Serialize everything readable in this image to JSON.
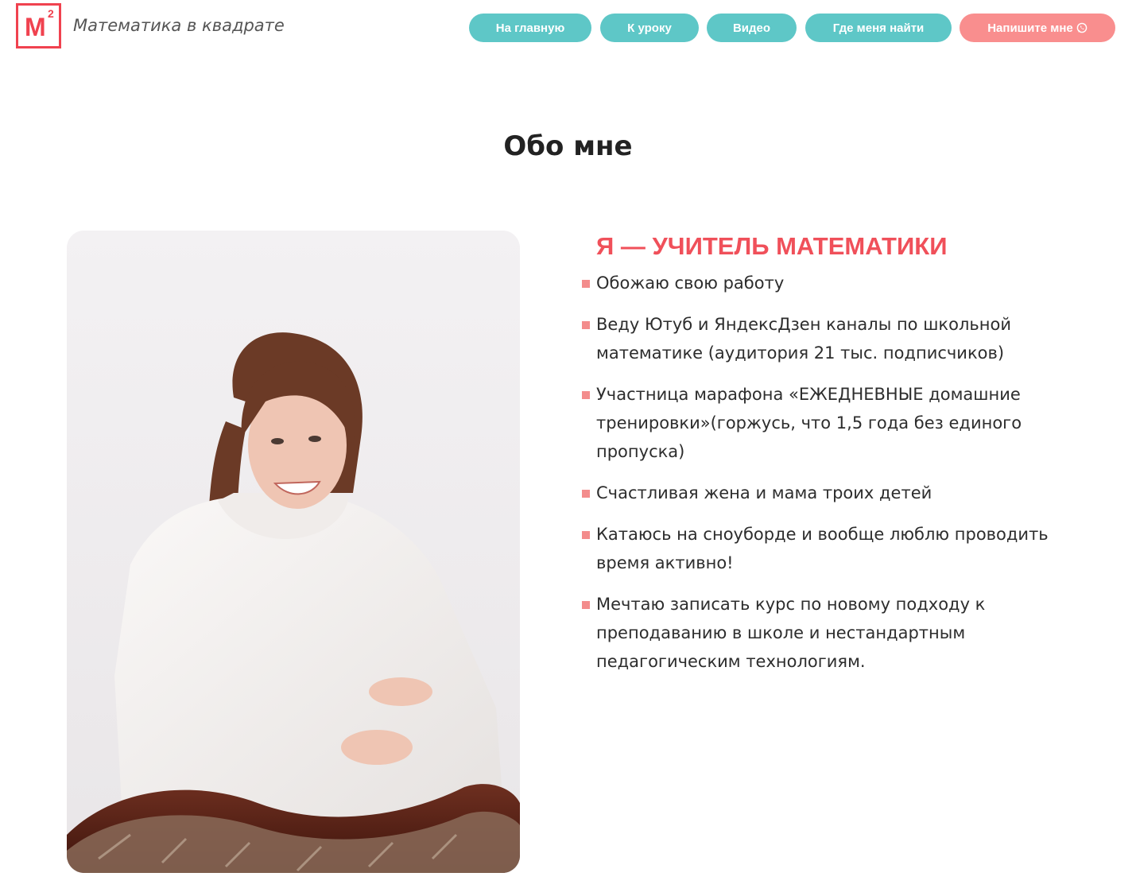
{
  "header": {
    "logo_letter": "M",
    "logo_sup": "2",
    "site_name": "Математика в квадрате",
    "nav": [
      {
        "label": "На главную"
      },
      {
        "label": "К уроку"
      },
      {
        "label": "Видео"
      },
      {
        "label": "Где меня найти"
      },
      {
        "label": "Напишите мне",
        "icon": "whatsapp-icon"
      }
    ]
  },
  "main": {
    "title": "Обо мне",
    "photo_alt": "teacher-portrait",
    "subtitle": "Я — УЧИТЕЛЬ МАТЕМАТИКИ",
    "facts": [
      "Обожаю свою работу",
      "Веду Ютуб и ЯндексДзен каналы по школьной математике (аудитория 21 тыс. подписчиков)",
      "Участница марафона «ЕЖЕДНЕВНЫЕ домашние тренировки»(горжусь, что 1,5 года без единого пропуска)",
      "Счастливая жена и мама троих детей",
      "Катаюсь на сноуборде и вообще люблю проводить время активно!",
      "Мечтаю записать курс по новому подходу к преподаванию в школе и нестандартным педагогическим технологиям."
    ]
  },
  "colors": {
    "accent_red": "#f0424f",
    "teal": "#5ec7c7",
    "pink": "#f98e8e",
    "bullet": "#f38c8c"
  }
}
